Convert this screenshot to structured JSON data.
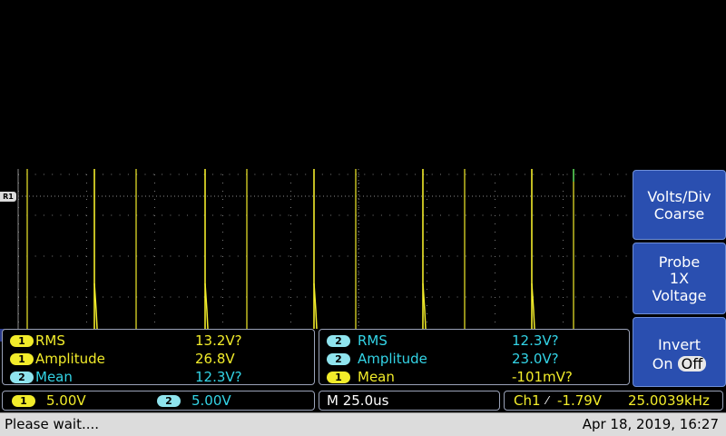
{
  "reference_marker": "R1",
  "measurements_left": [
    {
      "channel": "1",
      "channel_color": "yellow",
      "name": "RMS",
      "value": "13.2V?",
      "name_color": "yellow"
    },
    {
      "channel": "1",
      "channel_color": "yellow",
      "name": "Amplitude",
      "value": "26.8V",
      "name_color": "yellow"
    },
    {
      "channel": "2",
      "channel_color": "cyan",
      "name": "Mean",
      "value": "12.3V?",
      "name_color": "cyan"
    }
  ],
  "measurements_right": [
    {
      "channel": "2",
      "channel_color": "cyan",
      "name": "RMS",
      "value": "12.3V?",
      "name_color": "cyan"
    },
    {
      "channel": "2",
      "channel_color": "cyan",
      "name": "Amplitude",
      "value": "23.0V?",
      "name_color": "cyan"
    },
    {
      "channel": "1",
      "channel_color": "yellow",
      "name": "Mean",
      "value": "-101mV?",
      "name_color": "yellow"
    }
  ],
  "side_menu": {
    "volts_div": {
      "line1": "Volts/Div",
      "line2": "Coarse"
    },
    "probe": {
      "line1": "Probe",
      "line2": "1X",
      "line3": "Voltage"
    },
    "invert": {
      "line1": "Invert",
      "on": "On",
      "off": "Off"
    }
  },
  "status": {
    "ch1_label": "1",
    "ch1_scale": "5.00V",
    "ch2_label": "2",
    "ch2_scale": "5.00V",
    "timebase": "M 25.0us",
    "trigger_source": "Ch1",
    "trigger_slope": "⁄",
    "trigger_level": "-1.79V",
    "frequency": "25.0039kHz"
  },
  "bottom": {
    "message": "Please wait....",
    "datetime": "Apr 18, 2019, 16:27"
  },
  "colors": {
    "ch1": "#f2ec2a",
    "ch2": "#33d4e6",
    "menu": "#2a4fb0"
  }
}
